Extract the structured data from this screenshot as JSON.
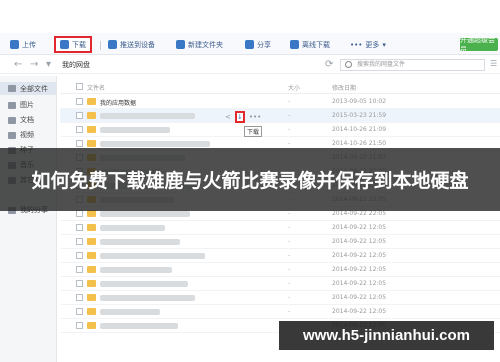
{
  "toolbar": {
    "upload": "上传",
    "download": "下载",
    "push_device": "推送到设备",
    "new_folder": "新建文件夹",
    "share": "分享",
    "offline_download": "离线下载",
    "more": "更多",
    "vip": "开通超级会员"
  },
  "nav": {
    "path": "我的网盘",
    "search_placeholder": "搜索我的网盘文件"
  },
  "sidebar": {
    "items": [
      {
        "label": "全部文件",
        "active": true
      },
      {
        "label": "图片"
      },
      {
        "label": "文档"
      },
      {
        "label": "视频"
      },
      {
        "label": "种子"
      },
      {
        "label": "音乐"
      },
      {
        "label": "其它"
      },
      {
        "label": "我的分享"
      }
    ]
  },
  "table": {
    "header_name": "文件名",
    "header_size": "大小",
    "header_date": "修改日期",
    "rows": [
      {
        "name": "我的应用数据",
        "size": "-",
        "date": "2013-09-05 10:02"
      },
      {
        "name": "",
        "size": "-",
        "date": "2015-03-23 21:59"
      },
      {
        "name": "",
        "size": "-",
        "date": "2014-10-26 21:09"
      },
      {
        "name": "",
        "size": "-",
        "date": "2014-10-26 21:50"
      },
      {
        "name": "",
        "size": "-",
        "date": "2014-09-22 21:07"
      },
      {
        "name": "",
        "size": "-",
        "date": "2014-09-22 22:05"
      },
      {
        "name": "",
        "size": "-",
        "date": "2014-09-22 22:05"
      },
      {
        "name": "",
        "size": "-",
        "date": "2014-09-22 22:05"
      },
      {
        "name": "",
        "size": "-",
        "date": "2014-09-22 22:05"
      },
      {
        "name": "",
        "size": "-",
        "date": "2014-09-22 12:05"
      },
      {
        "name": "",
        "size": "-",
        "date": "2014-09-22 12:05"
      },
      {
        "name": "",
        "size": "-",
        "date": "2014-09-22 12:05"
      },
      {
        "name": "",
        "size": "-",
        "date": "2014-09-22 12:05"
      },
      {
        "name": "",
        "size": "-",
        "date": "2014-09-22 12:05"
      },
      {
        "name": "",
        "size": "-",
        "date": "2014-09-22 12:05"
      },
      {
        "name": "",
        "size": "-",
        "date": "2014-09-22 12:05"
      },
      {
        "name": "",
        "size": "-",
        "date": "2014-09-22 12:05"
      }
    ]
  },
  "tooltip": "下载",
  "banner": "如何免费下载雄鹿与火箭比赛录像并保存到本地硬盘",
  "watermark": "www.h5-jinnianhui.com",
  "colors": {
    "accent_red": "#e0282e",
    "folder": "#f2c04b",
    "vip_green": "#4bb14d"
  }
}
